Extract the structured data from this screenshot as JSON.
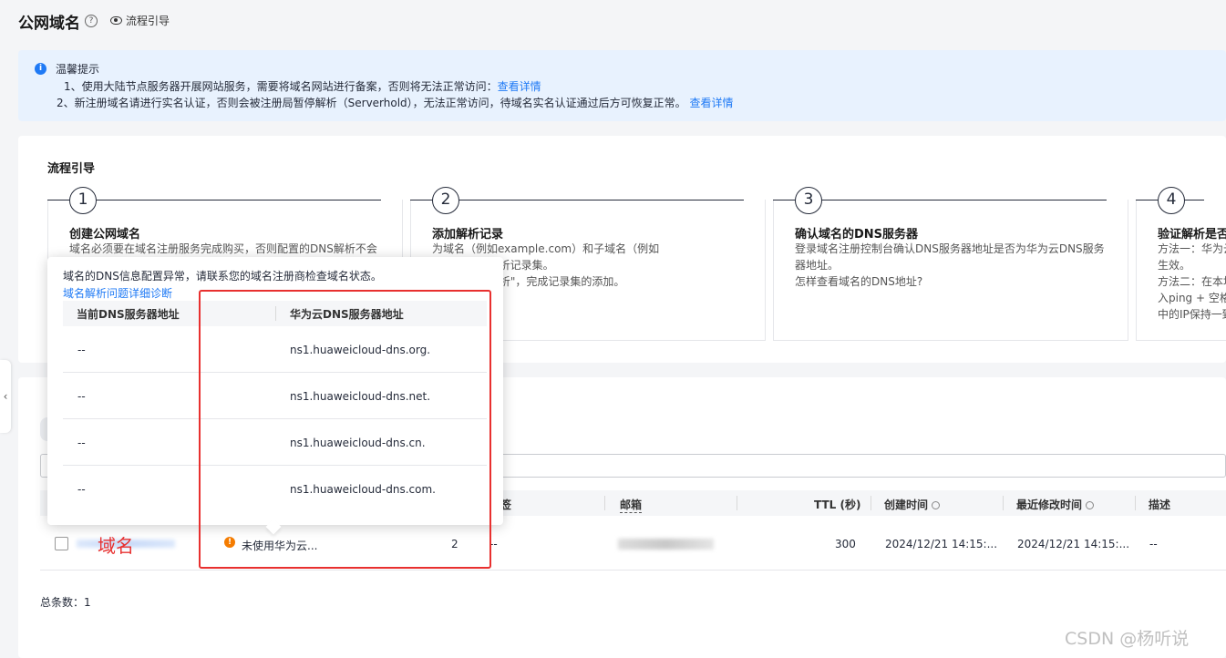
{
  "header": {
    "title": "公网域名",
    "help_icon": "question-icon",
    "guide_link": "流程引导"
  },
  "notice": {
    "title": "温馨提示",
    "line1": "1、使用大陆节点服务器开展网站服务，需要将域名网站进行备案，否则将无法正常访问：",
    "line1_link": "查看详情",
    "line2": "2、新注册域名请进行实名认证，否则会被注册局暂停解析（Serverhold），无法正常访问，待域名实名认证通过后方可恢复正常。",
    "line2_link": "查看详情"
  },
  "guide": {
    "heading": "流程引导",
    "steps": [
      {
        "num": "1",
        "title": "创建公网域名",
        "desc1": "域名必须要在域名注册服务完成购买，否则配置的DNS解析不会",
        "desc2": "",
        "desc3": ""
      },
      {
        "num": "2",
        "title": "添加解析记录",
        "desc1": "为域名（例如example.com）和子域名（例如",
        "desc2": "com）添加解析记录集。",
        "desc3": "> 快速添加解析\"，完成记录集的添加。"
      },
      {
        "num": "3",
        "title": "确认域名的DNS服务器",
        "desc1": "登录域名注册控制台确认DNS服务器地址是否为华为云DNS服务",
        "desc2": "器地址。",
        "link": "怎样查看域名的DNS地址?"
      },
      {
        "num": "4",
        "title": "验证解析是否",
        "desc1": "方法一：华为云",
        "desc2": "生效。",
        "desc3": "方法二：在本地",
        "desc4": "入ping + 空格",
        "desc5": "中的IP保持一致"
      }
    ]
  },
  "table": {
    "columns": {
      "tag": "签",
      "email": "邮箱",
      "ttl": "TTL (秒)",
      "created": "创建时间",
      "modified": "最近修改时间",
      "desc": "描述"
    },
    "row": {
      "status": "未使用华为云...",
      "records": "2",
      "tag": "--",
      "ttl": "300",
      "created": "2024/12/21 14:15:...",
      "modified": "2024/12/21 14:15:...",
      "desc": "--"
    },
    "total": "总条数：1"
  },
  "popup": {
    "message": "域名的DNS信息配置异常，请联系您的域名注册商检查域名状态。",
    "link": "域名解析问题详细诊断",
    "col_current": "当前DNS服务器地址",
    "col_huawei": "华为云DNS服务器地址",
    "rows": [
      {
        "current": "--",
        "huawei": "ns1.huaweicloud-dns.org."
      },
      {
        "current": "--",
        "huawei": "ns1.huaweicloud-dns.net."
      },
      {
        "current": "--",
        "huawei": "ns1.huaweicloud-dns.cn."
      },
      {
        "current": "--",
        "huawei": "ns1.huaweicloud-dns.com."
      }
    ]
  },
  "annotation": {
    "label": "域名"
  },
  "watermark": "CSDN @杨听说",
  "colors": {
    "accent": "#1f7af5",
    "annotation_red": "#e8302f",
    "warning": "#f57c00"
  }
}
